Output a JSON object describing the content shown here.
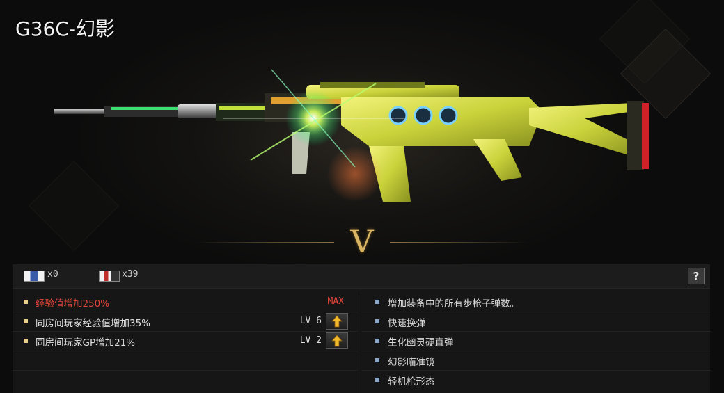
{
  "weapon": {
    "title": "G36C-幻影",
    "rank_glyph": "V"
  },
  "currency": [
    {
      "icon": "flag-token-icon",
      "amount": "x0"
    },
    {
      "icon": "flag-token-red-icon",
      "amount": "x39"
    }
  ],
  "help_label": "?",
  "bonuses": [
    {
      "text": "经验值增加250%",
      "status": "MAX",
      "highlight": true
    },
    {
      "text": "同房间玩家经验值增加35%",
      "level": "LV 6"
    },
    {
      "text": "同房间玩家GP增加21%",
      "level": "LV 2"
    }
  ],
  "features": [
    "增加装备中的所有步枪子弹数。",
    "快速换弹",
    "生化幽灵硬直弹",
    "幻影瞄准镜",
    "轻机枪形态"
  ],
  "colors": {
    "accent_gold": "#d8b463",
    "max_red": "#e0443a",
    "weapon_yellow": "#d6e23a",
    "glow_green": "#9bff6a"
  }
}
